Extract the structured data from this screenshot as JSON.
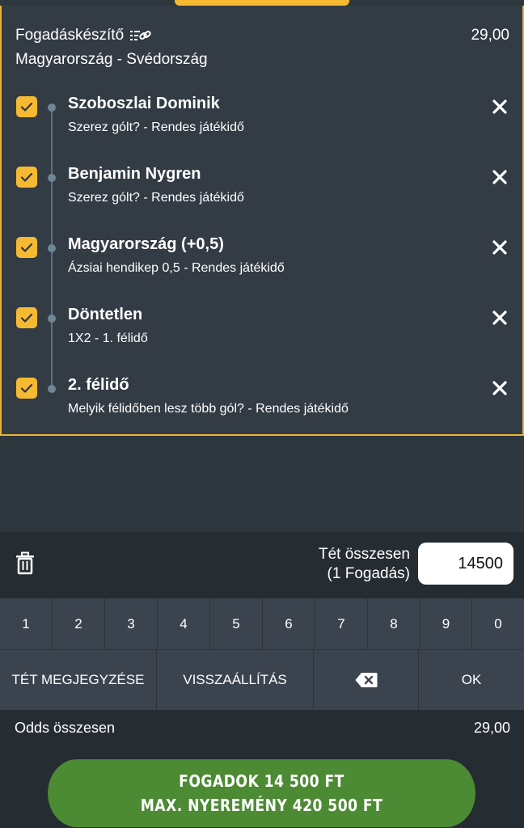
{
  "slip": {
    "title": "Fogadáskészítő",
    "odds": "29,00",
    "match": "Magyarország - Svédország"
  },
  "selections": [
    {
      "name": "Szoboszlai Dominik",
      "desc": "Szerez gólt? - Rendes játékidő",
      "checked": true
    },
    {
      "name": "Benjamin Nygren",
      "desc": "Szerez gólt? - Rendes játékidő",
      "checked": true
    },
    {
      "name": "Magyarország (+0,5)",
      "desc": "Ázsiai hendikep 0,5 - Rendes játékidő",
      "checked": true
    },
    {
      "name": "Döntetlen",
      "desc": "1X2 - 1. félidő",
      "checked": true
    },
    {
      "name": "2. félidő",
      "desc": "Melyik félidőben lesz több gól? - Rendes játékidő",
      "checked": true
    }
  ],
  "stake": {
    "label_line1": "Tét összesen",
    "label_line2": "(1 Fogadás)",
    "value": "14500"
  },
  "keypad": {
    "digits": [
      "1",
      "2",
      "3",
      "4",
      "5",
      "6",
      "7",
      "8",
      "9",
      "0"
    ],
    "save_stake": "TÉT MEGJEGYZÉSE",
    "reset": "VISSZAÁLLÍTÁS",
    "ok": "OK"
  },
  "summary": {
    "odds_label": "Odds összesen",
    "odds_value": "29,00"
  },
  "bet_button": {
    "line1": "FOGADOK 14 500 FT",
    "line2": "MAX. NYEREMÉNY 420 500 FT"
  },
  "colors": {
    "accent": "#f5b932",
    "button": "#4d8a34",
    "background": "#2f373e"
  }
}
